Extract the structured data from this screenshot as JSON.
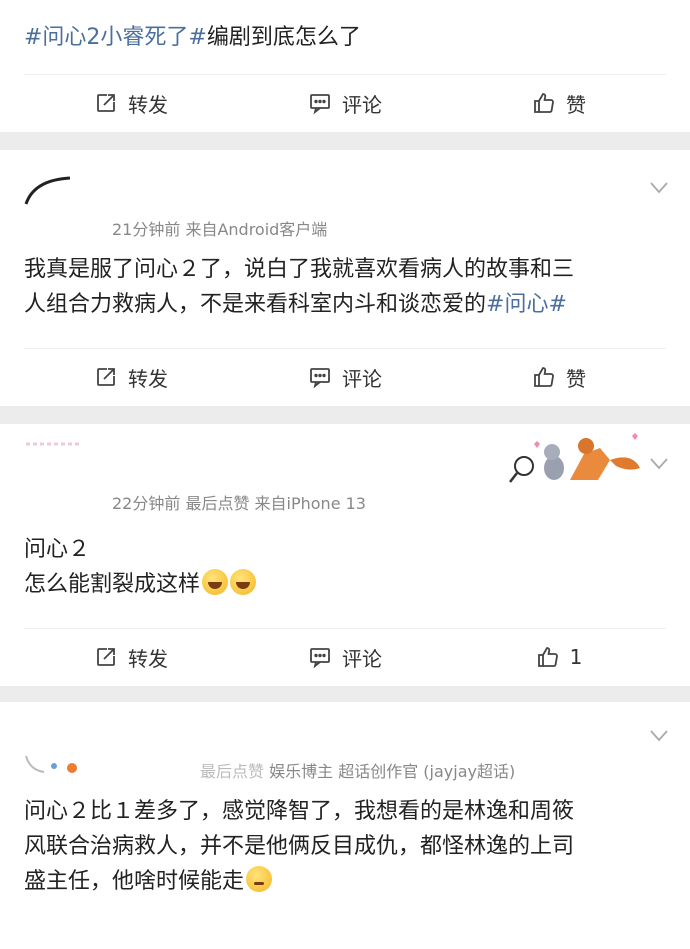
{
  "post1": {
    "hashtag_a": "#问心2小睿死了#",
    "text_rest": "编剧到底怎么了",
    "actions": {
      "repost": "转发",
      "comment": "评论",
      "like": "赞"
    }
  },
  "post2": {
    "meta": "21分钟前  来自Android客户端",
    "text_line1": "我真是服了问心２了，说白了我就喜欢看病人的故事和三",
    "text_line2_rest": "人组合力救病人，不是来看科室内斗和谈恋爱的",
    "hashtag": "#问心#",
    "actions": {
      "repost": "转发",
      "comment": "评论",
      "like": "赞"
    }
  },
  "post3": {
    "meta": "22分钟前 最后点赞  来自iPhone 13",
    "text_line1": "问心２",
    "text_line2": "怎么能割裂成这样",
    "actions": {
      "repost": "转发",
      "comment": "评论",
      "like": "1"
    }
  },
  "post4": {
    "meta_prefix": "最后点赞",
    "meta": "娱乐博主 超话创作官 (jayjay超话)",
    "text_line1": "问心２比１差多了，感觉降智了，我想看的是林逸和周筱",
    "text_line2": "风联合治病救人，并不是他俩反目成仇，都怪林逸的上司",
    "text_line3": "盛主任，他啥时候能走"
  },
  "colors": {
    "hashtag": "#4a6f9e",
    "background": "#ececec"
  },
  "icons": [
    "repost-icon",
    "comment-icon",
    "like-icon",
    "chevron-down-icon",
    "laughing-emoji",
    "thinking-emoji"
  ]
}
